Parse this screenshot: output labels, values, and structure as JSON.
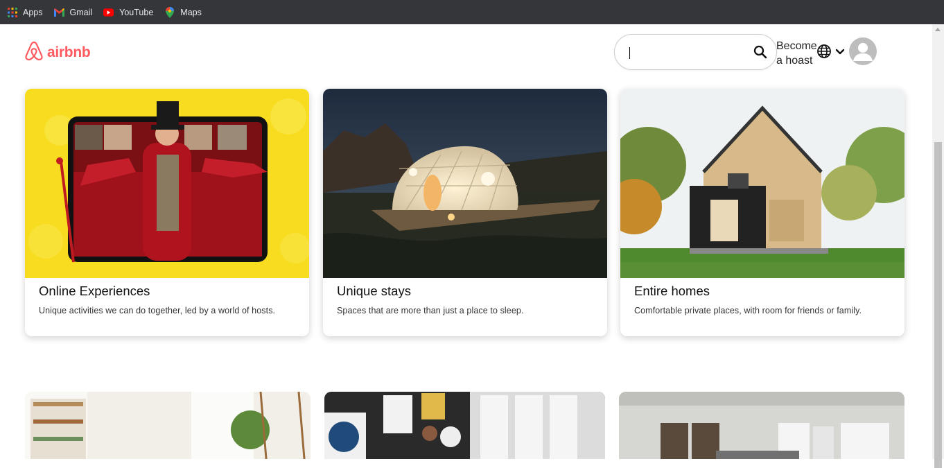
{
  "bookmarks": [
    {
      "label": "Apps",
      "icon": "apps-grid-icon"
    },
    {
      "label": "Gmail",
      "icon": "gmail-icon"
    },
    {
      "label": "YouTube",
      "icon": "youtube-icon"
    },
    {
      "label": "Maps",
      "icon": "maps-icon"
    }
  ],
  "header": {
    "logo_text": "airbnb",
    "search": {
      "value": "",
      "placeholder": ""
    },
    "host_line1": "Become",
    "host_line2": "a hoast"
  },
  "cards": [
    {
      "title": "Online Experiences",
      "description": "Unique activities we can do together, led by a world of hosts."
    },
    {
      "title": "Unique stays",
      "description": "Spaces that are more than just a place to sleep."
    },
    {
      "title": "Entire homes",
      "description": "Comfortable private places, with room for friends or family."
    }
  ],
  "colors": {
    "brand": "#ff5a5f",
    "bookmarks_bar": "#35363a"
  }
}
